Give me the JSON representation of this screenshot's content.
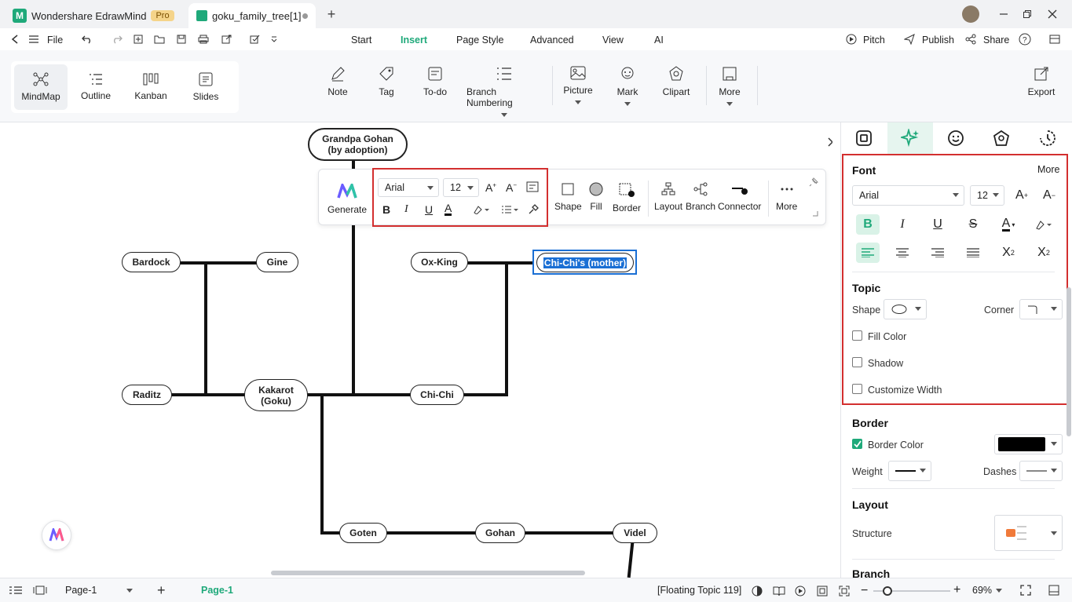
{
  "app": {
    "name": "Wondershare EdrawMind",
    "badge": "Pro",
    "doc_tab": "goku_family_tree[1]"
  },
  "menubar": {
    "file": "File",
    "tabs": [
      "Start",
      "Insert",
      "Page Style",
      "Advanced",
      "View",
      "AI"
    ],
    "active_tab": "Insert",
    "right": {
      "pitch": "Pitch",
      "publish": "Publish",
      "share": "Share"
    }
  },
  "ribbon": {
    "views": [
      "MindMap",
      "Outline",
      "Kanban",
      "Slides"
    ],
    "active_view": "MindMap",
    "buttons": [
      "Note",
      "Tag",
      "To-do",
      "Branch Numbering",
      "Picture",
      "Mark",
      "Clipart",
      "More"
    ],
    "export": "Export"
  },
  "mindmap": {
    "nodes": {
      "grandpa": "Grandpa Gohan\n(by adoption)",
      "bardock": "Bardock",
      "gine": "Gine",
      "oxking": "Ox-King",
      "chichi_mother": "Chi-Chi's (mother)",
      "raditz": "Raditz",
      "kakarot": "Kakarot\n(Goku)",
      "chichi": "Chi-Chi",
      "goten": "Goten",
      "gohan": "Gohan",
      "videl": "Videl"
    },
    "selected_node": "Chi-Chi's (mother)"
  },
  "floating_toolbar": {
    "generate": "Generate",
    "font": "Arial",
    "size": "12",
    "buttons": [
      "Shape",
      "Fill",
      "Border",
      "Layout",
      "Branch",
      "Connector",
      "More"
    ]
  },
  "panel": {
    "font_section": "Font",
    "more": "More",
    "font": "Arial",
    "size": "12",
    "topic_section": "Topic",
    "shape_label": "Shape",
    "corner_label": "Corner",
    "fill_color": "Fill Color",
    "shadow": "Shadow",
    "customize_width": "Customize Width",
    "border_section": "Border",
    "border_color": "Border Color",
    "weight": "Weight",
    "dashes": "Dashes",
    "layout_section": "Layout",
    "structure": "Structure",
    "branch_section": "Branch"
  },
  "status": {
    "page_select": "Page-1",
    "page_tab": "Page-1",
    "info": "[Floating Topic 119]",
    "zoom": "69%"
  },
  "colors": {
    "accent": "#1fa97a",
    "highlight": "#d32f2f",
    "selection": "#1a6fd4"
  }
}
